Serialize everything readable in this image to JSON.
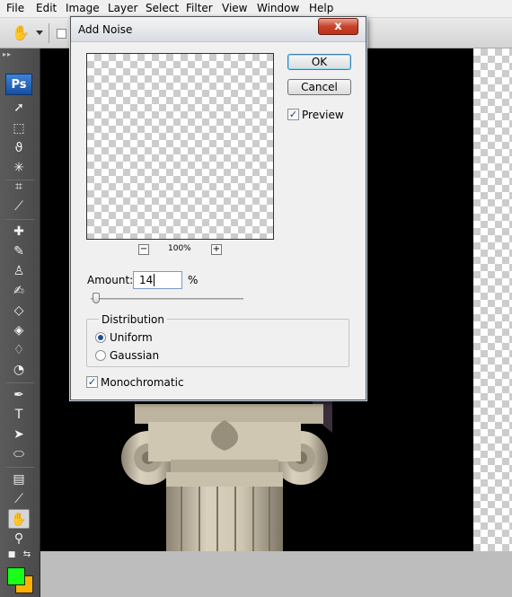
{
  "menubar": {
    "items": [
      "File",
      "Edit",
      "Image",
      "Layer",
      "Select",
      "Filter",
      "View",
      "Window",
      "Help"
    ]
  },
  "toolbox": {
    "logo": "Ps"
  },
  "colors": {
    "foreground": "#18ff18",
    "background": "#ffb300",
    "canvas": "#000000",
    "dialog_bg": "#f0f0f0"
  },
  "dialog": {
    "title": "Add Noise",
    "close_label": "x",
    "ok_label": "OK",
    "cancel_label": "Cancel",
    "preview_label": "Preview",
    "preview_checked": true,
    "zoom": "100%",
    "zoom_out_label": "−",
    "zoom_in_label": "+",
    "amount_label": "Amount:",
    "amount_value": "14",
    "amount_unit": "%",
    "distribution_label": "Distribution",
    "distribution_options": [
      "Uniform",
      "Gaussian"
    ],
    "distribution_selected": "Uniform",
    "monochromatic_label": "Monochromatic",
    "monochromatic_checked": true
  }
}
